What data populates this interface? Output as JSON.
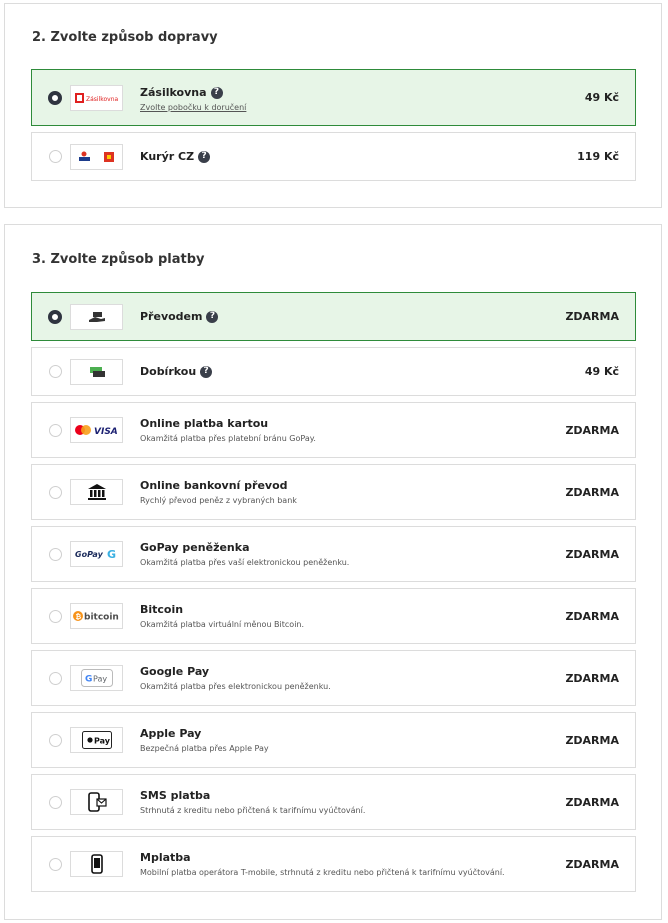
{
  "shipping": {
    "title": "2. Zvolte způsob dopravy",
    "options": [
      {
        "name": "Zásilkovna",
        "link": "Zvolte pobočku k doručení",
        "price": "49 Kč",
        "help": "?",
        "logo_text": "Zásilkovna",
        "selected": true,
        "logo_icon": "zasilkovna-logo"
      },
      {
        "name": "Kurýr CZ",
        "price": "119 Kč",
        "help": "?",
        "selected": false,
        "logo_icon": "ppl-dhl-logo"
      }
    ]
  },
  "payment": {
    "title": "3. Zvolte způsob platby",
    "options": [
      {
        "name": "Převodem",
        "price": "ZDARMA",
        "help": "?",
        "selected": true,
        "logo_icon": "bank-transfer-hand-icon"
      },
      {
        "name": "Dobírkou",
        "price": "49 Kč",
        "help": "?",
        "selected": false,
        "logo_icon": "cash-on-delivery-icon"
      },
      {
        "name": "Online platba kartou",
        "desc": "Okamžitá platba přes platební bránu GoPay.",
        "price": "ZDARMA",
        "selected": false,
        "logo_icon": "mastercard-visa-logo",
        "logo_text": "VISA"
      },
      {
        "name": "Online bankovní převod",
        "desc": "Rychlý převod peněz z vybraných bank",
        "price": "ZDARMA",
        "selected": false,
        "logo_icon": "bank-building-icon"
      },
      {
        "name": "GoPay peněženka",
        "desc": "Okamžitá platba přes vaší elektronickou peněženku.",
        "price": "ZDARMA",
        "selected": false,
        "logo_icon": "gopay-logo",
        "logo_text": "GoPay"
      },
      {
        "name": "Bitcoin",
        "desc": "Okamžitá platba virtuální měnou Bitcoin.",
        "price": "ZDARMA",
        "selected": false,
        "logo_icon": "bitcoin-logo",
        "logo_text": "bitcoin"
      },
      {
        "name": "Google Pay",
        "desc": "Okamžitá platba přes elektronickou peněženku.",
        "price": "ZDARMA",
        "selected": false,
        "logo_icon": "google-pay-logo",
        "logo_text": "Pay"
      },
      {
        "name": "Apple Pay",
        "desc": "Bezpečná platba přes Apple Pay",
        "price": "ZDARMA",
        "selected": false,
        "logo_icon": "apple-pay-logo",
        "logo_text": "Pay"
      },
      {
        "name": "SMS platba",
        "desc": "Strhnutá z kreditu nebo přičtená k tarifnímu vyúčtování.",
        "price": "ZDARMA",
        "selected": false,
        "logo_icon": "sms-phone-icon"
      },
      {
        "name": "Mplatba",
        "desc": "Mobilní platba operátora T-mobile, strhnutá z kreditu nebo přičtená k tarifnímu vyúčtování.",
        "price": "ZDARMA",
        "selected": false,
        "logo_icon": "mobile-phone-icon"
      }
    ]
  },
  "colors": {
    "selected_bg": "#e7f5e7",
    "selected_border": "#2e8b3a",
    "help_icon": "#3a3f4a"
  }
}
